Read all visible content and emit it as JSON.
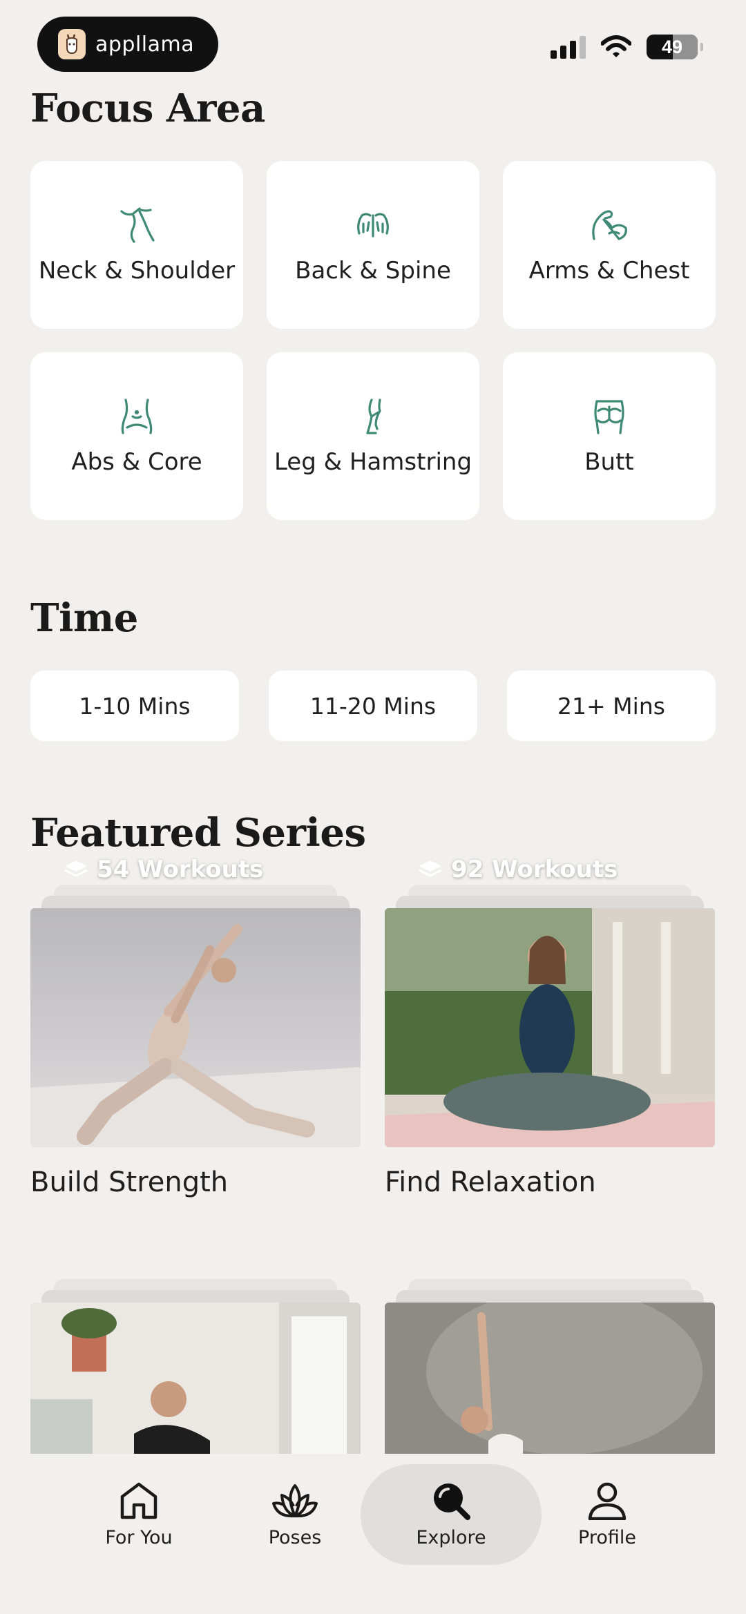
{
  "status_bar": {
    "app_name": "appllama",
    "battery": "49"
  },
  "sections": {
    "focus_title": "Focus Area",
    "time_title": "Time",
    "featured_title": "Featured Series"
  },
  "focus_areas": [
    {
      "label": "Neck & Shoulder",
      "icon": "neck-shoulder-icon"
    },
    {
      "label": "Back & Spine",
      "icon": "back-spine-icon"
    },
    {
      "label": "Arms & Chest",
      "icon": "arms-chest-icon"
    },
    {
      "label": "Abs & Core",
      "icon": "abs-core-icon"
    },
    {
      "label": "Leg & Hamstring",
      "icon": "leg-hamstring-icon"
    },
    {
      "label": "Butt",
      "icon": "butt-icon"
    }
  ],
  "time_options": [
    "1-10 Mins",
    "11-20 Mins",
    "21+ Mins"
  ],
  "featured_series": [
    {
      "title": "Build Strength",
      "count": "54 Workouts"
    },
    {
      "title": "Find Relaxation",
      "count": "92 Workouts"
    }
  ],
  "tabs": [
    {
      "label": "For You",
      "icon": "home-icon"
    },
    {
      "label": "Poses",
      "icon": "lotus-icon"
    },
    {
      "label": "Explore",
      "icon": "search-icon",
      "active": true
    },
    {
      "label": "Profile",
      "icon": "person-icon"
    }
  ],
  "colors": {
    "accent": "#3f8a73",
    "background": "#f1f0ee",
    "card": "#ffffff"
  }
}
